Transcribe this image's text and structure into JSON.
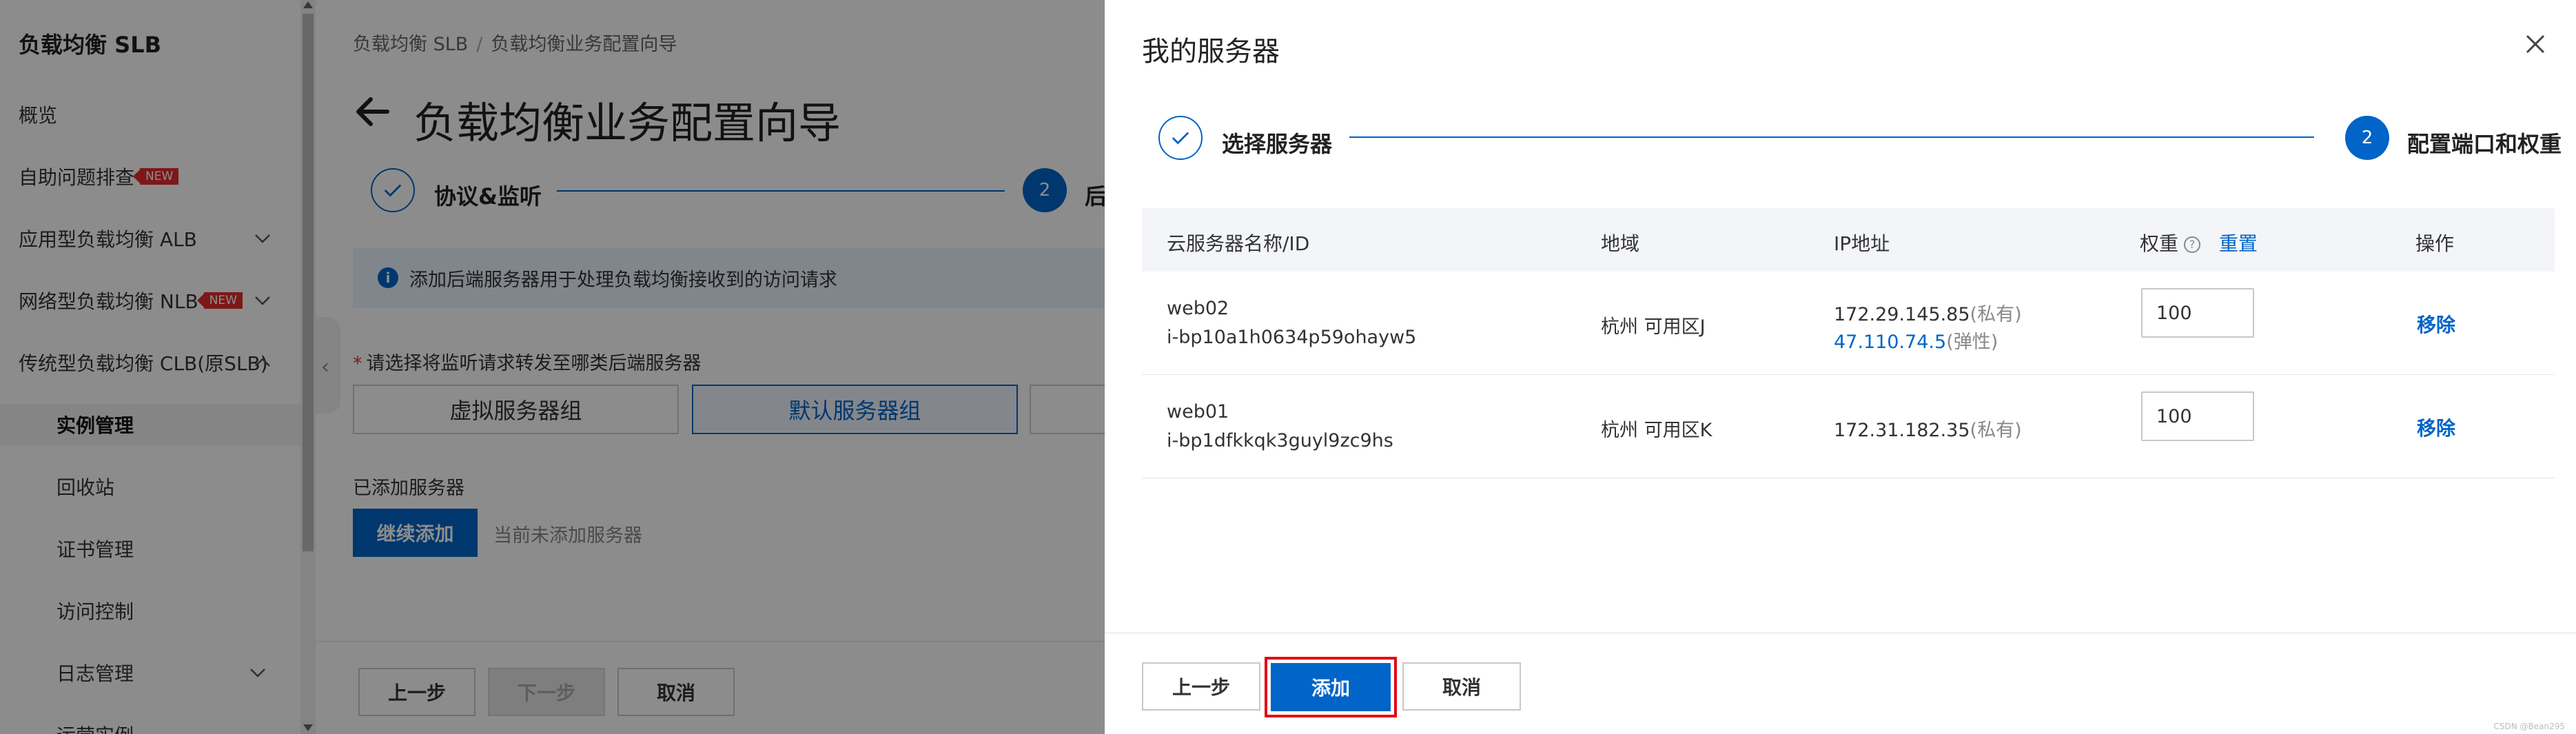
{
  "sidebar": {
    "title": "负载均衡 SLB",
    "items": [
      {
        "label": "概览"
      },
      {
        "label": "自助问题排查",
        "badge": "NEW"
      },
      {
        "label": "应用型负载均衡 ALB"
      },
      {
        "label": "网络型负载均衡 NLB",
        "badge": "NEW"
      },
      {
        "label": "传统型负载均衡 CLB(原SLB)"
      }
    ],
    "sub_items": [
      {
        "label": "实例管理"
      },
      {
        "label": "回收站"
      },
      {
        "label": "证书管理"
      },
      {
        "label": "访问控制"
      },
      {
        "label": "日志管理"
      },
      {
        "label": "运营实例"
      }
    ]
  },
  "main": {
    "breadcrumb": [
      "负载均衡 SLB",
      "负载均衡业务配置向导"
    ],
    "title": "负载均衡业务配置向导",
    "steps": [
      {
        "label": "协议&监听"
      },
      {
        "label": "后",
        "number": "2"
      }
    ],
    "info": "添加后端服务器用于处理负载均衡接收到的访问请求",
    "group_prompt": "请选择将监听请求转发至哪类后端服务器",
    "groups": [
      "虚拟服务器组",
      "默认服务器组"
    ],
    "added_label": "已添加服务器",
    "continue_add": "继续添加",
    "none_added": "当前未添加服务器",
    "footer": {
      "prev": "上一步",
      "next": "下一步",
      "cancel": "取消"
    }
  },
  "drawer": {
    "title": "我的服务器",
    "steps": [
      {
        "label": "选择服务器"
      },
      {
        "label": "配置端口和权重",
        "number": "2"
      }
    ],
    "table": {
      "headers": {
        "name": "云服务器名称/ID",
        "region": "地域",
        "ip": "IP地址",
        "weight": "权重",
        "reset": "重置",
        "action": "操作"
      },
      "rows": [
        {
          "name": "web02",
          "id": "i-bp10a1h0634p59ohayw5",
          "region": "杭州 可用区J",
          "private_ip": "172.29.145.85",
          "private_tag": "(私有)",
          "public_ip": "47.110.74.5",
          "public_tag": "(弹性)",
          "weight": "100",
          "action": "移除"
        },
        {
          "name": "web01",
          "id": "i-bp1dfkkqk3guyl9zc9hs",
          "region": "杭州 可用区K",
          "private_ip": "172.31.182.35",
          "private_tag": "(私有)",
          "weight": "100",
          "action": "移除"
        }
      ]
    },
    "footer": {
      "prev": "上一步",
      "add": "添加",
      "cancel": "取消"
    },
    "watermark": "CSDN @Bean295"
  },
  "colors": {
    "primary": "#0064c8",
    "highlight": "#e60012",
    "badge": "#e62d2d"
  }
}
